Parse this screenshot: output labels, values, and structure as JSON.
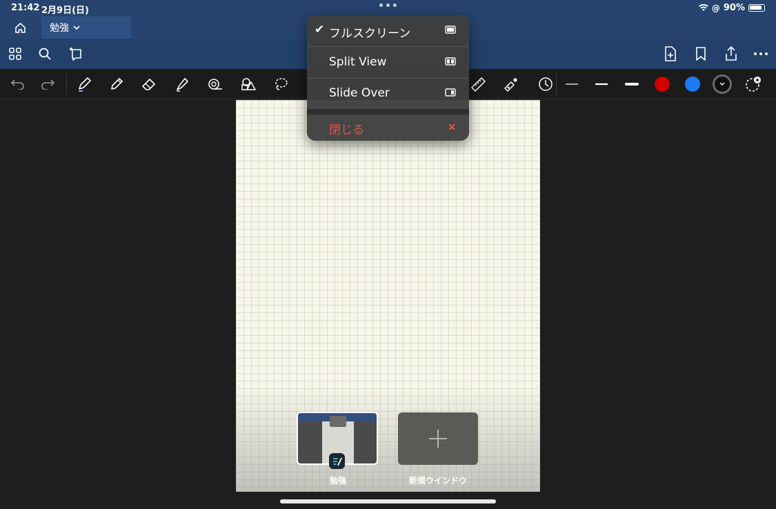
{
  "status": {
    "time": "21:42",
    "date": "2月9日(日)",
    "battery": "90%"
  },
  "tab": {
    "title": "勉強"
  },
  "menu": {
    "fullscreen": "フルスクリーン",
    "split_view": "Split View",
    "slide_over": "Slide Over",
    "close": "閉じる",
    "close_color": "#e5534b"
  },
  "toolbar": {
    "icons": [
      "home-icon",
      "grid-icon",
      "search-icon",
      "bookmark-add-icon",
      "new-page-icon",
      "bookmark-icon",
      "share-icon",
      "more-icon"
    ],
    "colors": [
      "#d00000",
      "#1a7bf5",
      "#101010"
    ]
  },
  "switcher": {
    "current_window": "勉強",
    "new_window": "新規ウインドウ"
  }
}
